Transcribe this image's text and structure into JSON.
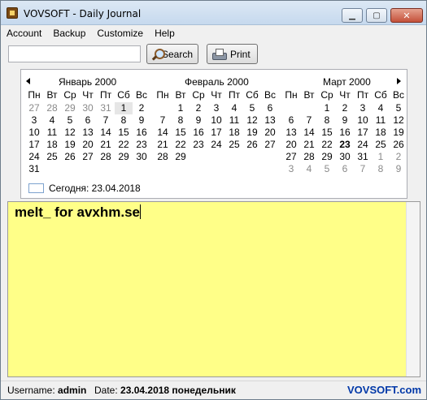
{
  "window": {
    "title": "VOVSOFT - Daily Journal",
    "min_glyph": "▁",
    "max_glyph": "▢",
    "close_glyph": "✕"
  },
  "menu": [
    "Account",
    "Backup",
    "Customize",
    "Help"
  ],
  "toolbar": {
    "search_value": "",
    "search_label": "Search",
    "print_label": "Print"
  },
  "calendar": {
    "weekday_headers": [
      "Пн",
      "Вт",
      "Ср",
      "Чт",
      "Пт",
      "Сб",
      "Вс"
    ],
    "months": [
      {
        "title": "Январь 2000",
        "rows": [
          [
            "27",
            "28",
            "29",
            "30",
            "31",
            "1",
            "2"
          ],
          [
            "3",
            "4",
            "5",
            "6",
            "7",
            "8",
            "9"
          ],
          [
            "10",
            "11",
            "12",
            "13",
            "14",
            "15",
            "16"
          ],
          [
            "17",
            "18",
            "19",
            "20",
            "21",
            "22",
            "23"
          ],
          [
            "24",
            "25",
            "26",
            "27",
            "28",
            "29",
            "30"
          ],
          [
            "31",
            "",
            "",
            "",
            "",
            "",
            ""
          ]
        ],
        "gray": [
          [
            0,
            0
          ],
          [
            0,
            1
          ],
          [
            0,
            2
          ],
          [
            0,
            3
          ],
          [
            0,
            4
          ]
        ],
        "selected": [
          [
            0,
            5
          ]
        ]
      },
      {
        "title": "Февраль 2000",
        "rows": [
          [
            "",
            "1",
            "2",
            "3",
            "4",
            "5",
            "6"
          ],
          [
            "7",
            "8",
            "9",
            "10",
            "11",
            "12",
            "13"
          ],
          [
            "14",
            "15",
            "16",
            "17",
            "18",
            "19",
            "20"
          ],
          [
            "21",
            "22",
            "23",
            "24",
            "25",
            "26",
            "27"
          ],
          [
            "28",
            "29",
            "",
            "",
            "",
            "",
            ""
          ],
          [
            "",
            "",
            "",
            "",
            "",
            "",
            ""
          ]
        ],
        "gray": [],
        "selected": []
      },
      {
        "title": "Март 2000",
        "rows": [
          [
            "",
            "",
            "1",
            "2",
            "3",
            "4",
            "5"
          ],
          [
            "6",
            "7",
            "8",
            "9",
            "10",
            "11",
            "12"
          ],
          [
            "13",
            "14",
            "15",
            "16",
            "17",
            "18",
            "19"
          ],
          [
            "20",
            "21",
            "22",
            "23",
            "24",
            "25",
            "26"
          ],
          [
            "27",
            "28",
            "29",
            "30",
            "31",
            "1",
            "2"
          ],
          [
            "3",
            "4",
            "5",
            "6",
            "7",
            "8",
            "9"
          ]
        ],
        "gray": [
          [
            4,
            5
          ],
          [
            4,
            6
          ],
          [
            5,
            0
          ],
          [
            5,
            1
          ],
          [
            5,
            2
          ],
          [
            5,
            3
          ],
          [
            5,
            4
          ],
          [
            5,
            5
          ],
          [
            5,
            6
          ]
        ],
        "bold": [
          [
            3,
            3
          ]
        ],
        "selected": []
      }
    ],
    "today_label": "Сегодня: 23.04.2018"
  },
  "editor": {
    "text": "melt_ for avxhm.se",
    "background": "#ffff88"
  },
  "status": {
    "username_label": "Username:",
    "username": "admin",
    "date_label": "Date:",
    "date_value": "23.04.2018 понедельник",
    "brand": "VOVSOFT.com"
  }
}
